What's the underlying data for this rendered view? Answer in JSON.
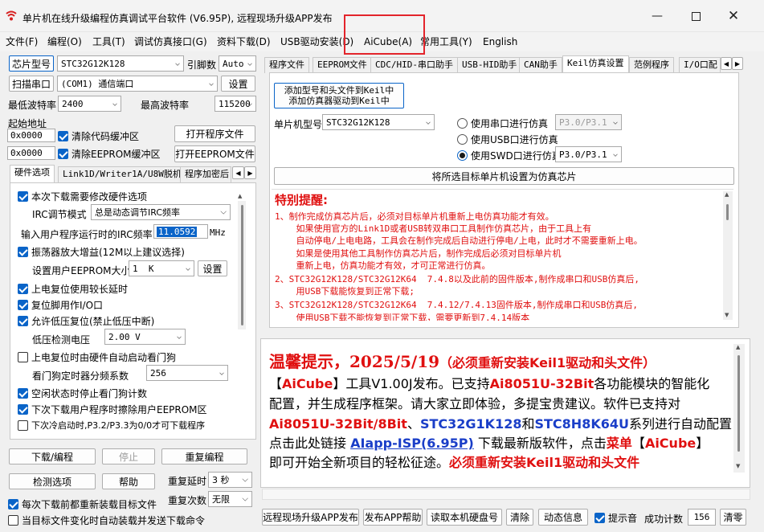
{
  "window": {
    "title": "单片机在线升级编程仿真调试平台软件 (V6.95P), 远程现场升级APP发布",
    "minimize_icon": "minimize-icon",
    "maximize_icon": "maximize-icon",
    "close_icon": "close-icon"
  },
  "menu": [
    "文件(F)",
    "编程(O)",
    "工具(T)",
    "调试仿真接口(G)",
    "资料下载(D)",
    "USB驱动安装(D)",
    "AiCube(A)",
    "常用工具(Y)",
    "English"
  ],
  "left": {
    "chip_type_btn": "芯片型号",
    "chip_type_value": "STC32G12K128",
    "pin_count_label": "引脚数",
    "pin_count_value": "Auto",
    "scan_port_btn": "扫描串口",
    "port_value": "(COM1) 通信端口",
    "settings_btn": "设置",
    "min_baud_label": "最低波特率",
    "min_baud_value": "2400",
    "max_baud_label": "最高波特率",
    "max_baud_value": "115200",
    "start_addr_label": "起始地址",
    "addr1_value": "0x0000",
    "clear_code_label": "清除代码缓冲区",
    "open_program_btn": "打开程序文件",
    "addr2_value": "0x0000",
    "clear_eeprom_label": "清除EEPROM缓冲区",
    "open_eeprom_btn": "打开EEPROM文件",
    "hw_tabs": [
      "硬件选项",
      "Link1D/Writer1A/U8W脱机",
      "程序加密后"
    ],
    "hw_options": {
      "modify_hw": "本次下载需要修改硬件选项",
      "irc_mode_label": "IRC调节模式",
      "irc_mode_value": "总是动态调节IRC频率",
      "irc_freq_label": "输入用户程序运行时的IRC频率",
      "irc_freq_value": "11.0592",
      "irc_freq_unit": "MHz",
      "osc_gain": "振荡器放大增益(12M以上建议选择)",
      "eeprom_size_label": "设置用户EEPROM大小",
      "eeprom_size_value": "1  K",
      "eeprom_set_btn": "设置",
      "power_reset_delay": "上电复位使用较长延时",
      "reset_pin_io": "复位脚用作I/O口",
      "low_voltage_reset": "允许低压复位(禁止低压中断)",
      "lv_detect_label": "低压检测电压",
      "lv_detect_value": "2.00 V",
      "watchdog_auto": "上电复位时由硬件自动启动看门狗",
      "watchdog_div_label": "看门狗定时器分频系数",
      "watchdog_div_value": "256",
      "idle_stop_wdt": "空闲状态时停止看门狗计数",
      "erase_eeprom_next": "下次下载用户程序时擦除用户EEPROM区",
      "cold_start": "下次冷启动时,P3.2/P3.3为0/0才可下载程序"
    },
    "download_btn": "下载/编程",
    "stop_btn": "停止",
    "reprogram_btn": "重复编程",
    "check_options_btn": "检测选项",
    "help_btn": "帮助",
    "repeat_delay_label": "重复延时",
    "repeat_delay_value": "3 秒",
    "reload_each": "每次下载前都重新装载目标文件",
    "repeat_count_label": "重复次数",
    "repeat_count_value": "无限",
    "auto_send": "当目标文件变化时自动装载并发送下载命令"
  },
  "right": {
    "tabs": [
      "程序文件",
      "EEPROM文件",
      "CDC/HID-串口助手",
      "USB-HID助手",
      "CAN助手",
      "Keil仿真设置",
      "范例程序",
      "I/O口配"
    ],
    "add_keil_btn_line1": "添加型号和头文件到Keil中",
    "add_keil_btn_line2": "添加仿真器驱动到Keil中",
    "mcu_label": "单片机型号",
    "mcu_value": "STC32G12K128",
    "radio_serial": "使用串口进行仿真",
    "radio_serial_port": "P3.0/P3.1",
    "radio_usb": "使用USB口进行仿真",
    "radio_swd": "使用SWD口进行仿真",
    "radio_swd_port": "P3.0/P3.1",
    "set_emulator_btn": "将所选目标单片机设置为仿真芯片",
    "notice_title": "特别提醒:",
    "notice_lines": [
      "1、制作完成仿真芯片后，必须对目标单片机重新上电仿真功能才有效。",
      "    如果使用官方的Link1D或者USB转双串口工具制作仿真芯片，由于工具上有",
      "    自动停电/上电电路，工具会在制作完成后自动进行停电/上电，此时才不需要重新上电。",
      "    如果是使用其他工具制作仿真芯片后，制作完成后必须对目标单片机",
      "    重新上电，仿真功能才有效，才可正常进行仿真。",
      "2、STC32G12K128/STC32G12K64  7.4.8以及此前的固件版本,制作成串口和USB仿真后,",
      "    用USB下载能恢复到正常下载;",
      "3、STC32G12K128/STC32G12K64  7.4.12/7.4.13固件版本,制作成串口和USB仿真后,",
      "    使用USB下载不能恢复到正常下载，需要更新到7.4.14版本"
    ],
    "info": {
      "headline_a": "温馨提示，2025/5/19",
      "headline_b": "（必须重新安装Keil1驱动和头文件）",
      "l2_a": "【",
      "l2_b": "AiCube",
      "l2_c": "】工具V1.00J发布。已支持",
      "l2_d": "Ai8051U-32Bit",
      "l2_e": "各功能模块的智能化",
      "l3": "配置，并生成程序框架。请大家立即体验，多提宝贵建议。软件已支持对",
      "l4_a": "Ai8051U-32Bit/8Bit",
      "l4_b": "、",
      "l4_c": "STC32G1K128",
      "l4_d": "和",
      "l4_e": "STC8H8K64U",
      "l4_f": "系列进行自动配置 。",
      "l5_a": "点击此处链接 ",
      "l5_b": "AIapp-ISP(6.95P)",
      "l5_c": " 下载最新版软件，点击",
      "l5_d": "菜单",
      "l5_e": "【",
      "l5_f": "AiCube",
      "l5_g": "】",
      "l6_a": "即可开始全新项目的轻松征途。",
      "l6_b": "必须重新安装Keil1驱动和头文件"
    },
    "bottom": {
      "remote_btn": "远程现场升级APP发布",
      "publish_help_btn": "发布APP帮助",
      "read_disk_btn": "读取本机硬盘号",
      "clear_btn": "清除",
      "dynamic_btn": "动态信息",
      "beep_label": "提示音",
      "success_label": "成功计数",
      "success_value": "156",
      "clear_count_btn": "清零"
    }
  }
}
